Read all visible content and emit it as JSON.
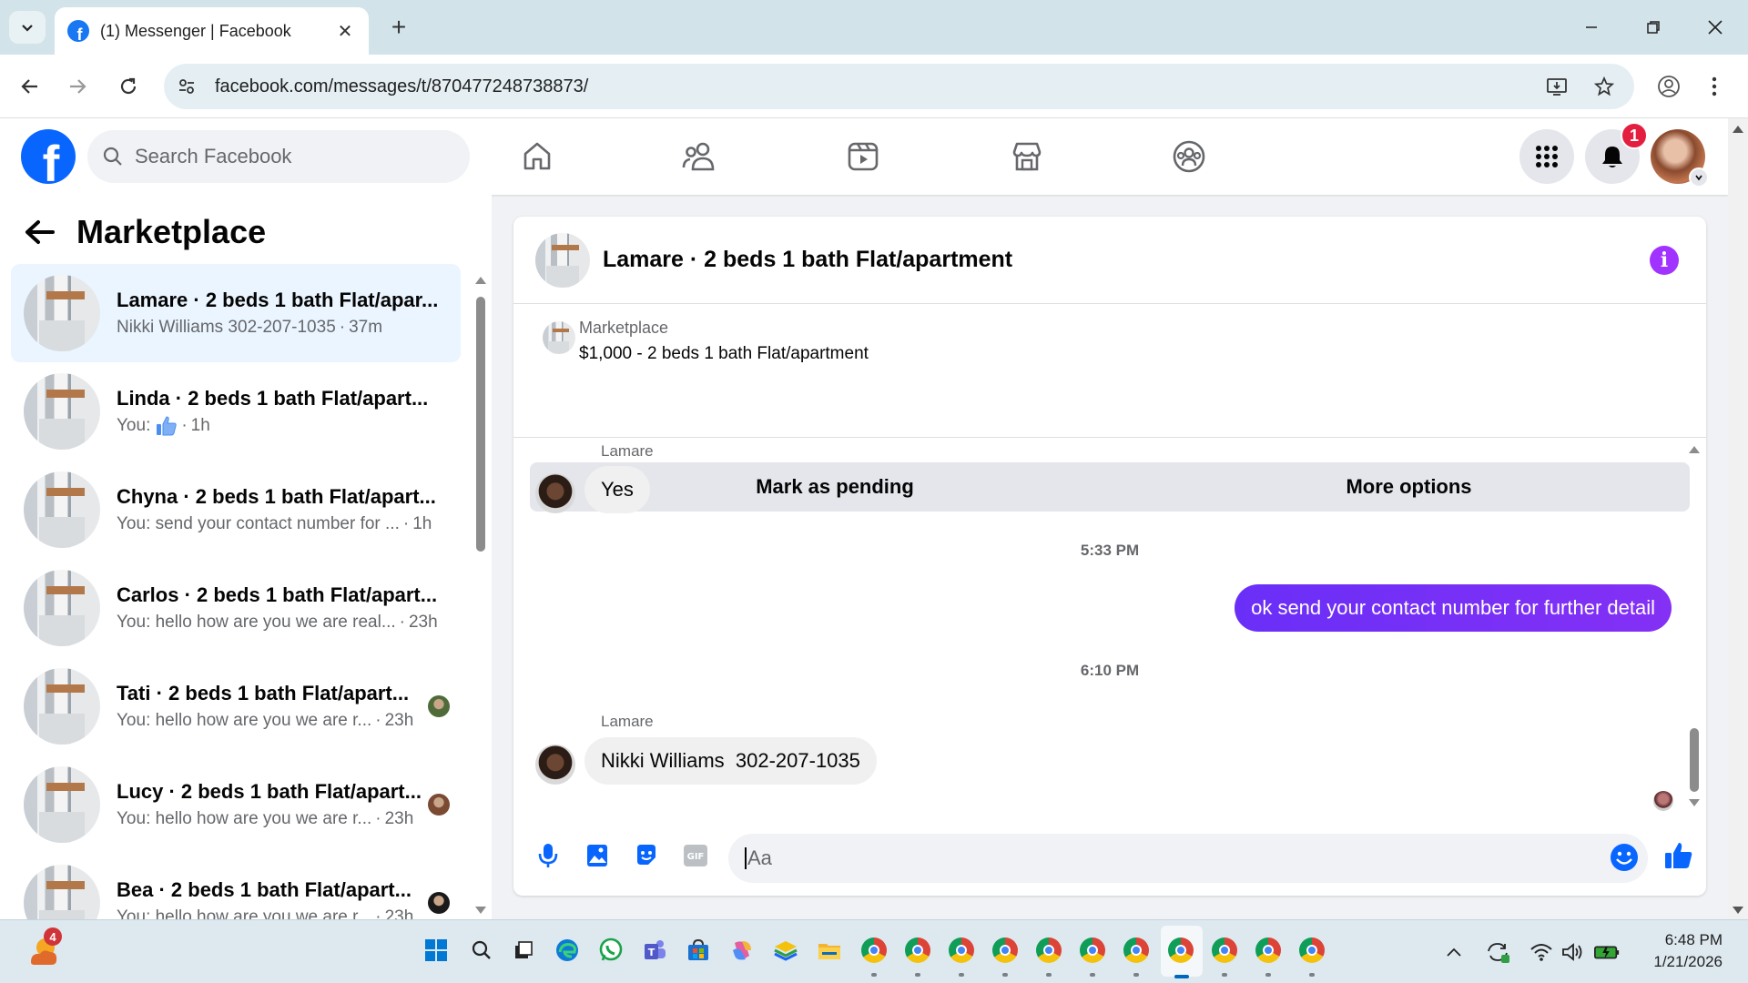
{
  "browser": {
    "tab_title": "(1) Messenger | Facebook",
    "url": "facebook.com/messages/t/870477248738873/",
    "new_tab_label": "+",
    "tab_close_label": "✕"
  },
  "fb_header": {
    "search_placeholder": "Search Facebook",
    "notification_count": "1",
    "nav_icons": [
      "home-icon",
      "friends-icon",
      "video-icon",
      "marketplace-icon",
      "groups-icon"
    ]
  },
  "left_pane": {
    "title": "Marketplace",
    "conversations": [
      {
        "name": "Lamare · 2 beds 1 bath Flat/apar...",
        "sub": "Nikki Williams 302-207-1035",
        "time": "37m",
        "active": true,
        "seen_avatar": false
      },
      {
        "name": "Linda · 2 beds 1 bath Flat/apart...",
        "sub": "You:",
        "time": "1h",
        "like": true,
        "seen_avatar": false
      },
      {
        "name": "Chyna · 2 beds 1 bath Flat/apart...",
        "sub": "You: send your contact number for ...",
        "time": "1h",
        "seen_avatar": false
      },
      {
        "name": "Carlos · 2 beds 1 bath Flat/apart...",
        "sub": "You: hello how are you we are real...",
        "time": "23h",
        "seen_avatar": false
      },
      {
        "name": "Tati · 2 beds 1 bath Flat/apart...",
        "sub": "You: hello how are you we are r...",
        "time": "23h",
        "seen_avatar": true,
        "seen_color": "#4f6b3a"
      },
      {
        "name": "Lucy · 2 beds 1 bath Flat/apart...",
        "sub": "You: hello how are you we are r...",
        "time": "23h",
        "seen_avatar": true,
        "seen_color": "#7a4a33"
      },
      {
        "name": "Bea · 2 beds 1 bath Flat/apart...",
        "sub": "You: hello how are you we are r...",
        "time": "23h",
        "seen_avatar": true,
        "seen_color": "#1a1a1a"
      }
    ]
  },
  "chat": {
    "title": "Lamare · 2 beds 1 bath Flat/apartment",
    "listing_label": "Marketplace",
    "listing_price": "$1,000 - 2 beds 1 bath Flat/apartment",
    "mark_pending_label": "Mark as pending",
    "more_options_label": "More options",
    "messages": {
      "sender_1": "Lamare",
      "msg_1": "Yes",
      "time_1": "5:33 PM",
      "msg_out": "ok send your contact number for further detail",
      "time_2": "6:10 PM",
      "sender_2": "Lamare",
      "msg_2": "Nikki Williams  302-207-1035"
    },
    "composer_placeholder": "Aa"
  },
  "taskbar": {
    "weather_badge": "4",
    "time": "6:48 PM",
    "date": "1/21/2026"
  },
  "colors": {
    "fb_blue": "#0866ff",
    "messenger_purple": "#7c2ef6",
    "active_conv": "#ebf5ff"
  }
}
